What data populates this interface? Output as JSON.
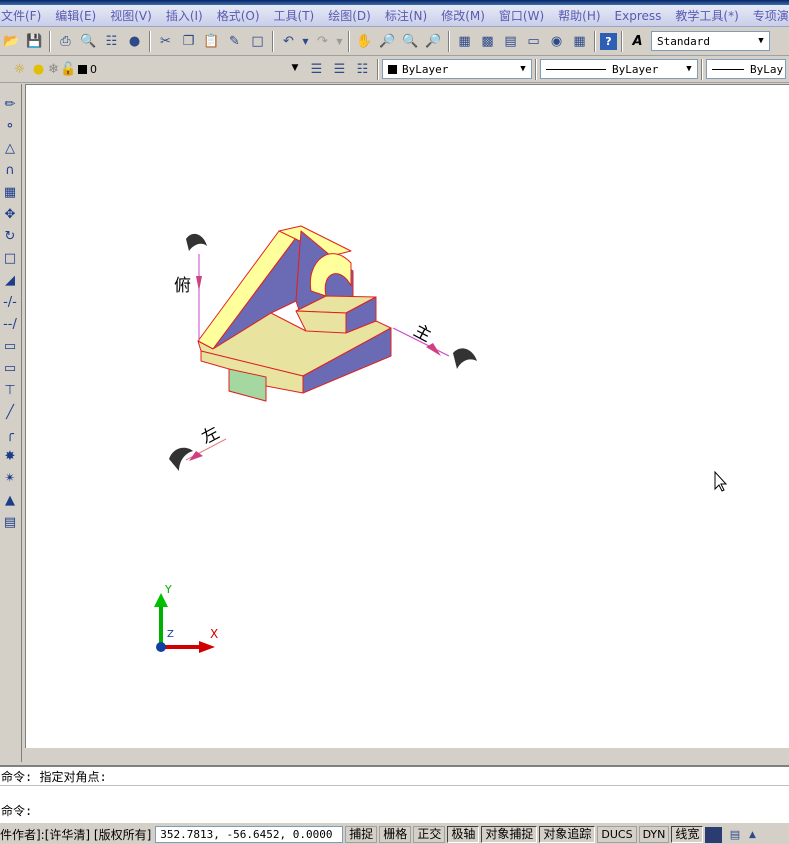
{
  "menu": [
    "文件(F)",
    "编辑(E)",
    "视图(V)",
    "插入(I)",
    "格式(O)",
    "工具(T)",
    "绘图(D)",
    "标注(N)",
    "修改(M)",
    "窗口(W)",
    "帮助(H)",
    "Express",
    "教学工具(*)",
    "专项演示("
  ],
  "toolbar1": {
    "text_style": "Standard"
  },
  "toolbar2": {
    "layer": "0",
    "color": "ByLayer",
    "linetype": "ByLayer",
    "lineweight": "ByLay"
  },
  "drawing": {
    "label_top": "俯",
    "label_front": "主",
    "label_left": "左",
    "ucs_y": "Y",
    "ucs_x": "X",
    "ucs_z": "Z"
  },
  "colors": {
    "top_face": "#ffff9c",
    "side_face": "#6b6bb5",
    "front_face": "#e8e4a0",
    "green_face": "#a4d8a0",
    "edge": "#e02020",
    "menu_text": "#5a5ab0"
  },
  "command": {
    "line1": "命令: 指定对角点:",
    "line2": "命令:"
  },
  "status": {
    "author": "件作者]:[许华清] [版权所有]",
    "coords": "352.7813, -56.6452, 0.0000",
    "buttons": [
      "捕捉",
      "栅格",
      "正交",
      "极轴",
      "对象捕捉",
      "对象追踪",
      "DUCS",
      "DYN",
      "线宽"
    ]
  }
}
